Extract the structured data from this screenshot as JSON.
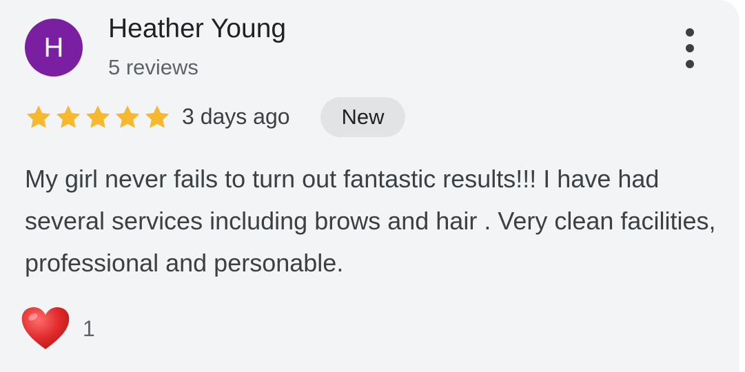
{
  "review": {
    "author": {
      "initial": "H",
      "name": "Heather Young",
      "review_count": "5 reviews",
      "avatar_color": "#7b1fa2"
    },
    "rating": {
      "value": 5,
      "max": 5,
      "star_color": "#f5b82e",
      "icon": "star-icon"
    },
    "time_ago": "3 days ago",
    "badge": "New",
    "text": "My girl never fails to turn out fantastic results!!! I have had several services including brows and hair . Very clean facilities, professional and personable.",
    "reactions": {
      "icon": "heart-icon",
      "color": "#e02b2b",
      "count": "1"
    },
    "menu_icon": "more-vert-icon"
  }
}
